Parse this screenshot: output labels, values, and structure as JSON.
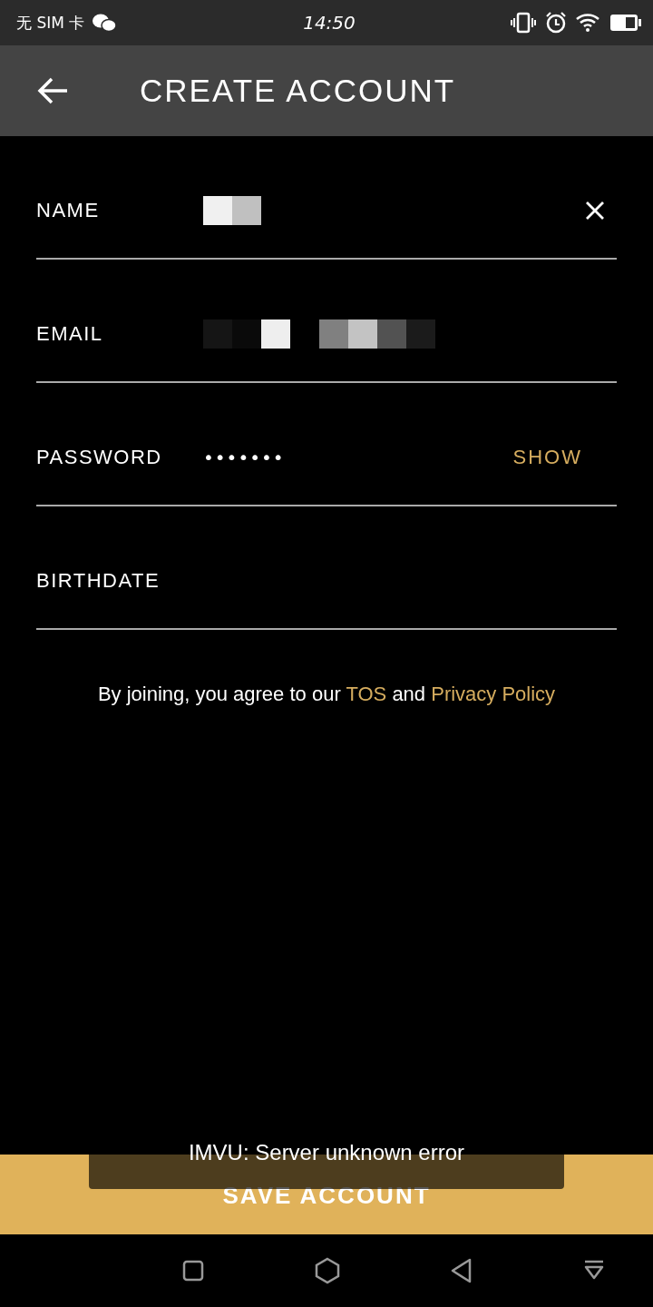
{
  "status_bar": {
    "carrier": "无 SIM 卡",
    "time": "14:50"
  },
  "header": {
    "title": "CREATE ACCOUNT"
  },
  "fields": [
    {
      "kind": "text",
      "label": "NAME",
      "value_masked": true,
      "clear": true
    },
    {
      "kind": "email",
      "label": "EMAIL",
      "value_masked": true
    },
    {
      "kind": "password",
      "label": "PASSWORD",
      "value": "•••••••",
      "toggle": "SHOW"
    },
    {
      "kind": "date",
      "label": "BIRTHDATE"
    }
  ],
  "terms": {
    "text": "By joining, you agree to our ",
    "tos": "TOS",
    "joiner": " and ",
    "privacy": "Privacy Policy"
  },
  "save_button": {
    "label": "SAVE ACCOUNT"
  },
  "toast": {
    "text": "IMVU: Server unknown error"
  }
}
